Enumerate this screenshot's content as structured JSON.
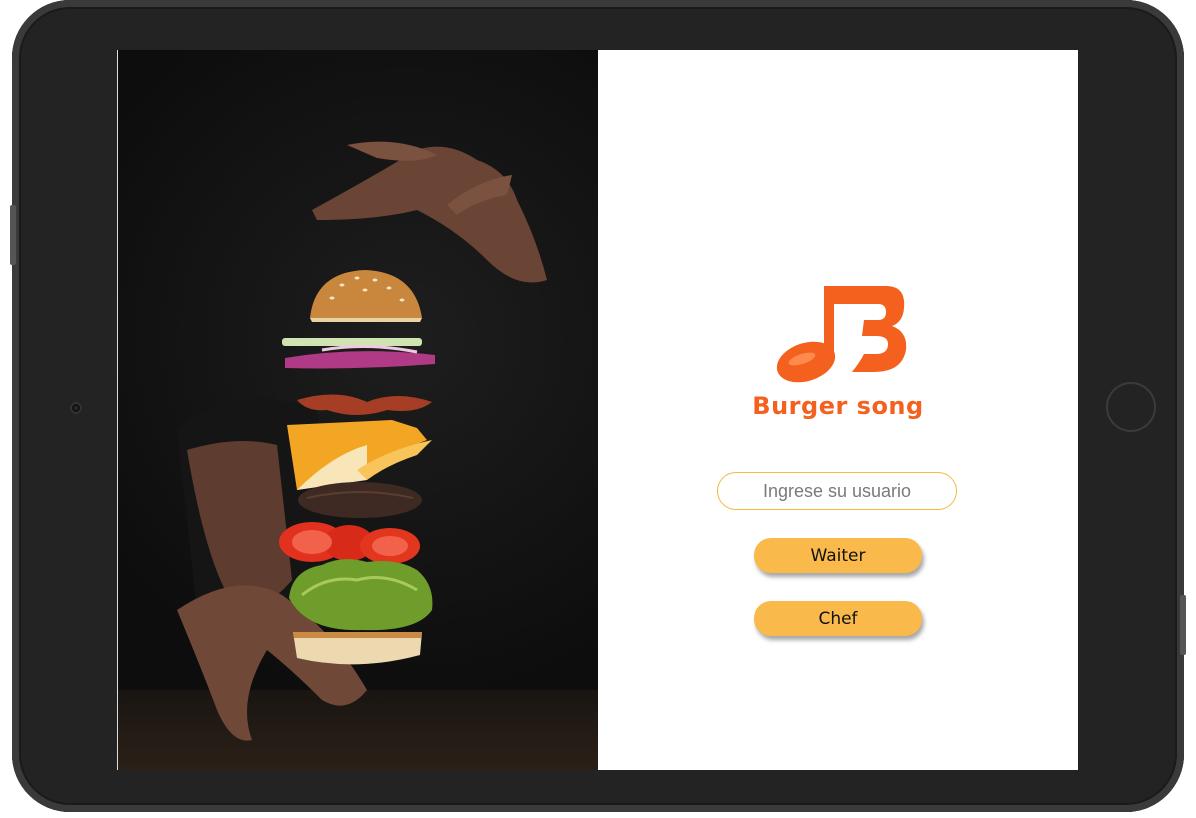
{
  "brand": {
    "name": "Burger song",
    "color": "#f4601d"
  },
  "login": {
    "user_placeholder": "Ingrese su usuario",
    "user_value": ""
  },
  "roles": {
    "waiter_label": "Waiter",
    "chef_label": "Chef"
  },
  "colors": {
    "button": "#f9b94b",
    "input_border": "#f5b942",
    "device": "#232323"
  },
  "icons": {
    "logo": "music-note-b-icon",
    "photo": "floating-burger-photo"
  }
}
